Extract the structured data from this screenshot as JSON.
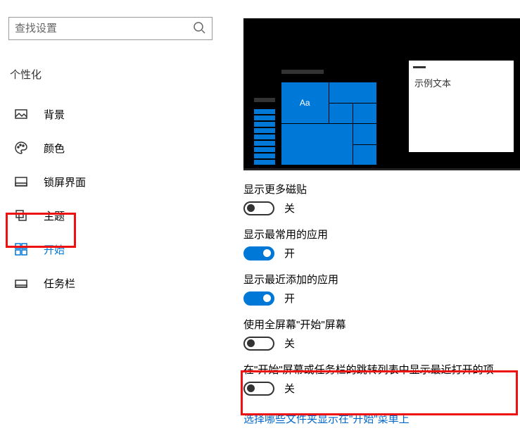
{
  "search": {
    "placeholder": "查找设置"
  },
  "section": "个性化",
  "nav": [
    {
      "label": "背景"
    },
    {
      "label": "颜色"
    },
    {
      "label": "锁屏界面"
    },
    {
      "label": "主题"
    },
    {
      "label": "开始"
    },
    {
      "label": "任务栏"
    }
  ],
  "preview": {
    "sample_text": "示例文本",
    "aa": "Aa"
  },
  "settings": [
    {
      "label": "显示更多磁贴",
      "value": false,
      "state": "关"
    },
    {
      "label": "显示最常用的应用",
      "value": true,
      "state": "开"
    },
    {
      "label": "显示最近添加的应用",
      "value": true,
      "state": "开"
    },
    {
      "label": "使用全屏幕\"开始\"屏幕",
      "value": false,
      "state": "关"
    },
    {
      "label": "在\"开始\"屏幕或任务栏的跳转列表中显示最近打开的项",
      "value": false,
      "state": "关"
    }
  ],
  "link": "选择哪些文件夹显示在\"开始\"菜单上"
}
